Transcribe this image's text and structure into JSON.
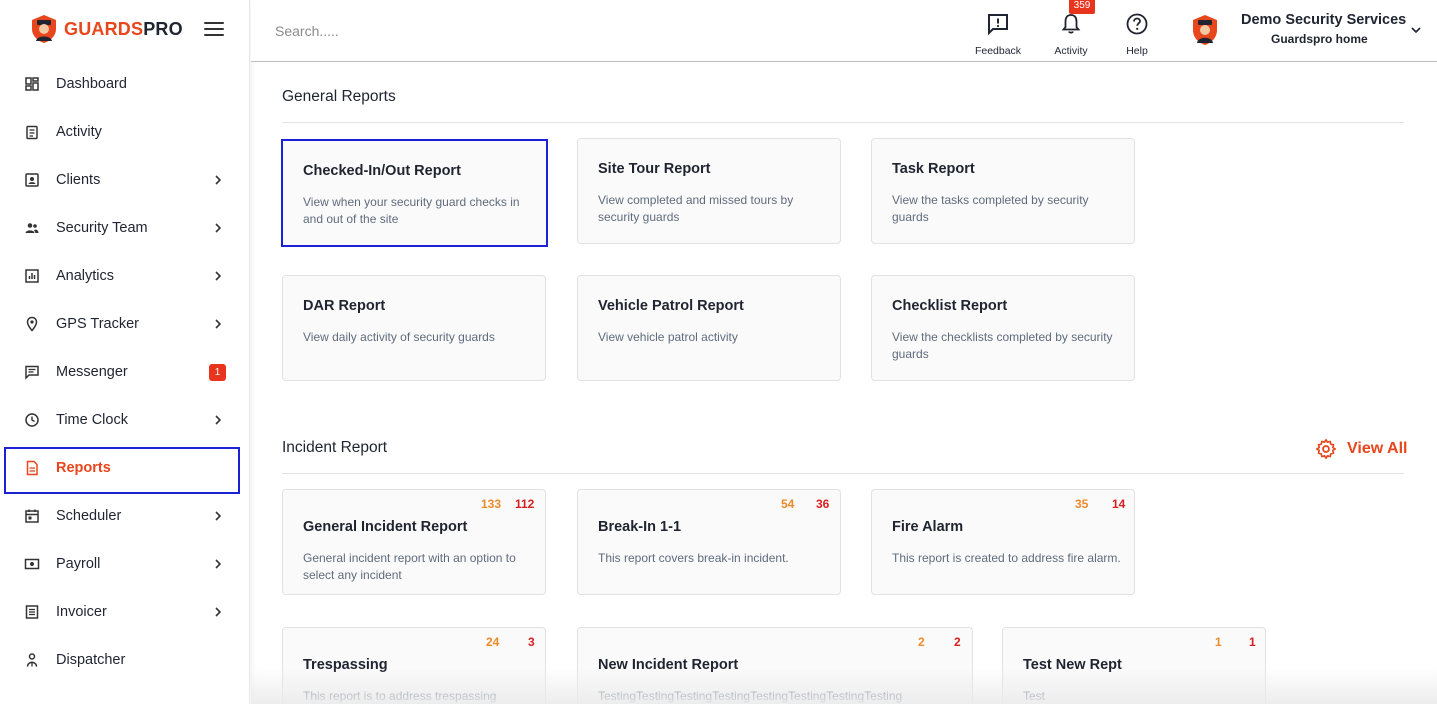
{
  "brand": {
    "part1": "GUARDS",
    "part2": "PRO"
  },
  "colors": {
    "accent": "#e8461c",
    "selection": "#1b22d6",
    "count_orange": "#ee8a2a",
    "count_red": "#d62020"
  },
  "sidebar": {
    "items": [
      {
        "label": "Dashboard",
        "icon": "dashboard-icon",
        "chevron": false
      },
      {
        "label": "Activity",
        "icon": "clipboard-icon",
        "chevron": false
      },
      {
        "label": "Clients",
        "icon": "contact-card-icon",
        "chevron": true
      },
      {
        "label": "Security Team",
        "icon": "people-icon",
        "chevron": true
      },
      {
        "label": "Analytics",
        "icon": "bar-chart-icon",
        "chevron": true
      },
      {
        "label": "GPS Tracker",
        "icon": "location-pin-icon",
        "chevron": true
      },
      {
        "label": "Messenger",
        "icon": "message-icon",
        "badge": "1"
      },
      {
        "label": "Time Clock",
        "icon": "clock-icon",
        "chevron": true
      },
      {
        "label": "Reports",
        "icon": "document-icon",
        "active": true
      },
      {
        "label": "Scheduler",
        "icon": "calendar-icon",
        "chevron": true
      },
      {
        "label": "Payroll",
        "icon": "money-icon",
        "chevron": true
      },
      {
        "label": "Invoicer",
        "icon": "invoice-icon",
        "chevron": true
      },
      {
        "label": "Dispatcher",
        "icon": "dispatcher-icon",
        "chevron": false
      }
    ]
  },
  "header": {
    "search_placeholder": "Search.....",
    "feedback_label": "Feedback",
    "activity_label": "Activity",
    "activity_badge": "359",
    "help_label": "Help",
    "profile_name": "Demo Security Services",
    "profile_sub": "Guardspro home"
  },
  "general_reports": {
    "title": "General Reports",
    "cards": [
      {
        "title": "Checked-In/Out Report",
        "desc": "View when your security guard checks in and out of the site",
        "selected": true
      },
      {
        "title": "Site Tour Report",
        "desc": "View completed and missed tours by security guards"
      },
      {
        "title": "Task Report",
        "desc": "View the tasks completed by security guards"
      },
      {
        "title": "DAR Report",
        "desc": "View daily activity of security guards"
      },
      {
        "title": "Vehicle Patrol Report",
        "desc": "View vehicle patrol activity"
      },
      {
        "title": "Checklist Report",
        "desc": "View the checklists completed by security guards"
      }
    ]
  },
  "incident_report": {
    "title": "Incident Report",
    "view_all": "View All",
    "cards": [
      {
        "title": "General Incident Report",
        "desc": "General incident report with an option to select any incident",
        "count1": "133",
        "count2": "112"
      },
      {
        "title": "Break-In 1-1",
        "desc": "This report covers break-in incident.",
        "count1": "54",
        "count2": "36"
      },
      {
        "title": "Fire Alarm",
        "desc": "This report is created to address fire alarm.",
        "count1": "35",
        "count2": "14"
      },
      {
        "title": "Trespassing",
        "desc": "This report is to address trespassing incident",
        "count1": "24",
        "count2": "3"
      },
      {
        "title": "New Incident Report",
        "desc": "TestingTestingTestingTestingTestingTestingTestingTesting",
        "count1": "2",
        "count2": "2"
      },
      {
        "title": "Test New Rept",
        "desc": "Test",
        "count1": "1",
        "count2": "1"
      }
    ]
  }
}
